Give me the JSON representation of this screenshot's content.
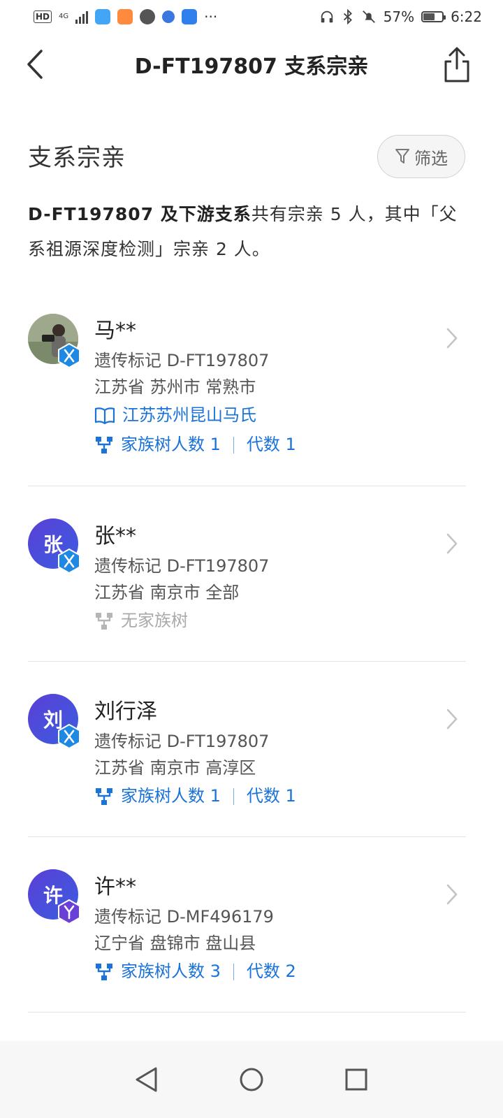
{
  "status_bar": {
    "hd": "HD",
    "network": "4G",
    "battery": "57%",
    "time": "6:22",
    "more": "···"
  },
  "header": {
    "title": "D-FT197807 支系宗亲"
  },
  "section": {
    "title": "支系宗亲",
    "filter_label": "筛选",
    "summary_bold": "D-FT197807 及下游支系",
    "summary_rest": "共有宗亲 5 人，其中「父系祖源深度检测」宗亲 2 人。"
  },
  "relatives": [
    {
      "avatar_text": "",
      "avatar_kind": "photo",
      "badge": "X",
      "name": "马**",
      "marker": "遗传标记 D-FT197807",
      "location": "江苏省 苏州市 常熟市",
      "lineage": "江苏苏州昆山马氏",
      "tree_people": "家族树人数 1",
      "generations": "代数 1",
      "no_tree": ""
    },
    {
      "avatar_text": "张",
      "avatar_kind": "letter",
      "badge": "X",
      "name": "张**",
      "marker": "遗传标记 D-FT197807",
      "location": "江苏省 南京市 全部",
      "lineage": "",
      "tree_people": "",
      "generations": "",
      "no_tree": "无家族树"
    },
    {
      "avatar_text": "刘",
      "avatar_kind": "letter",
      "badge": "X",
      "name": "刘行泽",
      "marker": "遗传标记 D-FT197807",
      "location": "江苏省 南京市 高淳区",
      "lineage": "",
      "tree_people": "家族树人数 1",
      "generations": "代数 1",
      "no_tree": ""
    },
    {
      "avatar_text": "许",
      "avatar_kind": "letter",
      "badge": "Y",
      "name": "许**",
      "marker": "遗传标记 D-MF496179",
      "location": "辽宁省 盘锦市 盘山县",
      "lineage": "",
      "tree_people": "家族树人数 3",
      "generations": "代数 2",
      "no_tree": ""
    }
  ],
  "colors": {
    "accent": "#1a73d9",
    "avatar_gradient_start": "#5a3fd6",
    "avatar_gradient_end": "#3b5de0",
    "badge_x": "#1e88e5",
    "badge_y": "#6a3fd8"
  },
  "icons": {
    "back": "back-arrow-icon",
    "share": "share-icon",
    "filter": "funnel-icon",
    "book": "book-icon",
    "tree": "family-tree-icon",
    "chevron": "chevron-right-icon"
  }
}
